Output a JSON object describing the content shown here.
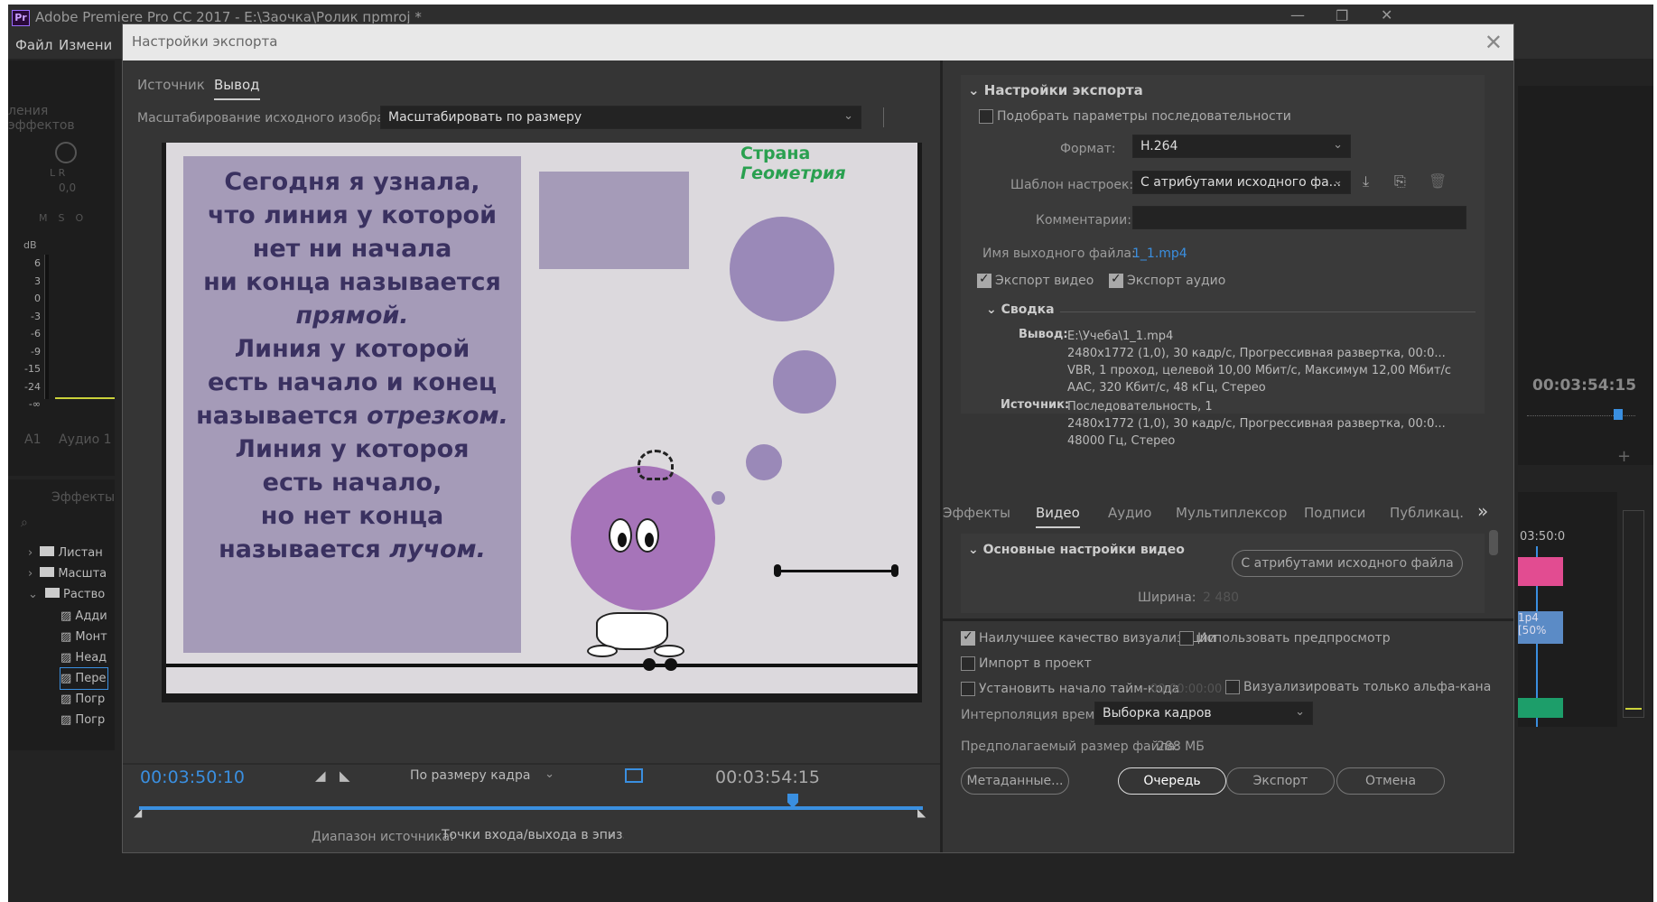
{
  "app": {
    "title": "Adobe Premiere Pro CC 2017 - E:\\Заочка\\Ролик прmroj *",
    "menu": [
      "Файл",
      "Измени"
    ],
    "window_controls": {
      "min": "—",
      "max": "❐",
      "close": "✕"
    }
  },
  "background": {
    "effects_panel_header": "ления эффектов",
    "meter_lr": "L R",
    "meter_value": "0,0",
    "msr_buttons": [
      "M",
      "S",
      "O"
    ],
    "db_label": "dB",
    "db_scale": [
      "6",
      "3",
      "0",
      "-3",
      "-6",
      "-9",
      "-15",
      "-24",
      "-∞"
    ],
    "track_a1": "A1",
    "track_audio1": "Аудио 1",
    "effects_tab": "Эффекты",
    "folders": [
      "Листан",
      "Масшта",
      "Раство"
    ],
    "effects_items": [
      "Адди",
      "Монт",
      "Неад",
      "Пере",
      "Погр",
      "Погр"
    ],
    "right_timecode": "00:03:54:15",
    "right_timecode2": "03:50:0",
    "clip_label": "1p4 [50%"
  },
  "dialog": {
    "title": "Настройки экспорта",
    "close": "✕",
    "tabs": {
      "source": "Источник",
      "output": "Вывод"
    },
    "scaling_label": "Масштабирование исходного изображения:",
    "scaling_value": "Масштабировать по размеру",
    "preview": {
      "brand_a": "Страна ",
      "brand_b": "Геометрия",
      "lines": [
        "Сегодня я узнала,",
        "что линия у которой",
        "нет ни начала",
        "ни конца называется",
        "прямой.",
        "Линия у которой",
        "есть начало и конец",
        "называется отрезком.",
        "Линия у котороя",
        "есть начало,",
        "но нет конца",
        "называется лучом."
      ]
    },
    "player": {
      "current_time": "00:03:50:10",
      "fit": "По размеру кадра",
      "end_time": "00:03:54:15",
      "range_label": "Диапазон источника:",
      "range_value": "Точки входа/выхода в эпиз..."
    },
    "settings": {
      "section_title": "Настройки экспорта",
      "match_sequence": "Подобрать параметры последовательности",
      "format_label": "Формат:",
      "format_value": "H.264",
      "preset_label": "Шаблон настроек:",
      "preset_value": "С атрибутами исходного фа...",
      "comments_label": "Комментарии:",
      "comments_value": "",
      "output_name_label": "Имя выходного файла:",
      "output_name_value": "1_1.mp4",
      "export_video": "Экспорт видео",
      "export_audio": "Экспорт аудио",
      "summary_title": "Сводка",
      "output_label": "Вывод:",
      "output_lines": [
        "E:\\Учеба\\1_1.mp4",
        "2480x1772 (1,0), 30 кадр/с, Прогрессивная развертка, 00:0...",
        "VBR, 1 проход, целевой 10,00 Мбит/с, Максимум 12,00 Мбит/с",
        "AAC, 320 Кбит/с, 48 кГц, Стерео"
      ],
      "source_label": "Источник:",
      "source_lines": [
        "Последовательность, 1",
        "2480x1772 (1,0), 30 кадр/с, Прогрессивная развертка, 00:0...",
        "48000 Гц, Стерео"
      ]
    },
    "tabs2": [
      "Эффекты",
      "Видео",
      "Аудио",
      "Мультиплексор",
      "Подписи",
      "Публикац."
    ],
    "tabs2_more": "»",
    "video": {
      "section_title": "Основные настройки видео",
      "match_source_button": "С атрибутами исходного файла",
      "width_label": "Ширина:",
      "width_value": "2 480"
    },
    "bottom": {
      "max_render": "Наилучшее качество визуализации",
      "use_previews": "Использовать предпросмотр",
      "import_project": "Импорт в проект",
      "set_start_tc": "Установить начало тайм-кода",
      "start_tc_value": "00:00:00:00",
      "alpha_only": "Визуализировать только альфа-кана",
      "interp_label": "Интерполяция времени:",
      "interp_value": "Выборка кадров",
      "filesize_label": "Предполагаемый размер файла:",
      "filesize_value": "288 МБ",
      "metadata_button": "Метаданные...",
      "queue_button": "Очередь",
      "export_button": "Экспорт",
      "cancel_button": "Отмена"
    }
  },
  "colors": {
    "accent": "#3a8fe0",
    "brand_green": "#2aa050",
    "panel": "#353535",
    "text_purple": "#3a3160"
  }
}
